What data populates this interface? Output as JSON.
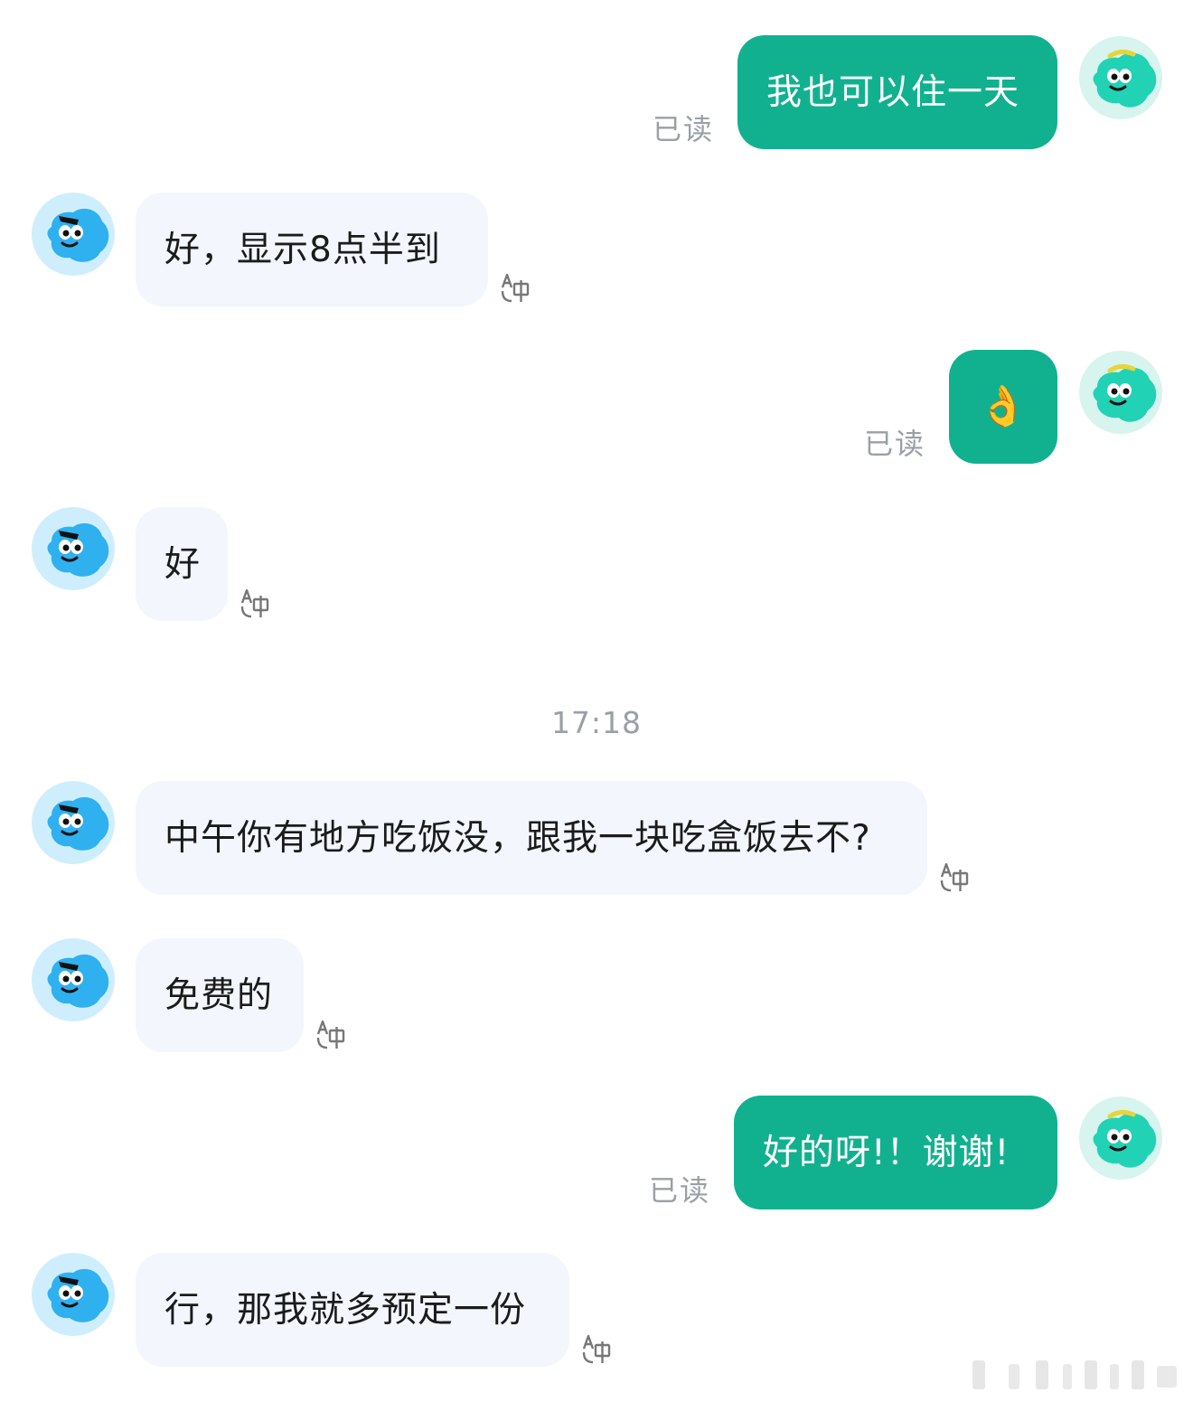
{
  "messages": [
    {
      "side": "out",
      "text": "我也可以住一天",
      "status": "已读"
    },
    {
      "side": "in",
      "text": "好，显示8点半到"
    },
    {
      "side": "out",
      "text": "👌",
      "status": "已读"
    },
    {
      "side": "in",
      "text": "好"
    },
    {
      "side": "in",
      "text": "中午你有地方吃饭没，跟我一块吃盒饭去不?"
    },
    {
      "side": "in",
      "text": "免费的"
    },
    {
      "side": "out",
      "text": "好的呀!！谢谢!",
      "status": "已读"
    },
    {
      "side": "in",
      "text": "行，那我就多预定一份"
    }
  ],
  "timestamp": "17:18",
  "icons": {
    "incoming_avatar": "blue-blob-character-avatar",
    "outgoing_avatar": "teal-blob-character-avatar",
    "translate": "translate-icon"
  },
  "colors": {
    "outgoing_bubble": "#11b18f",
    "incoming_bubble": "#f3f6fd",
    "read_status": "#9aa0a6",
    "incoming_avatar_bg": "#cfeefd",
    "incoming_avatar_body": "#2fb1f0",
    "outgoing_avatar_bg": "#d7f4ee",
    "outgoing_avatar_body": "#22d2b5"
  }
}
